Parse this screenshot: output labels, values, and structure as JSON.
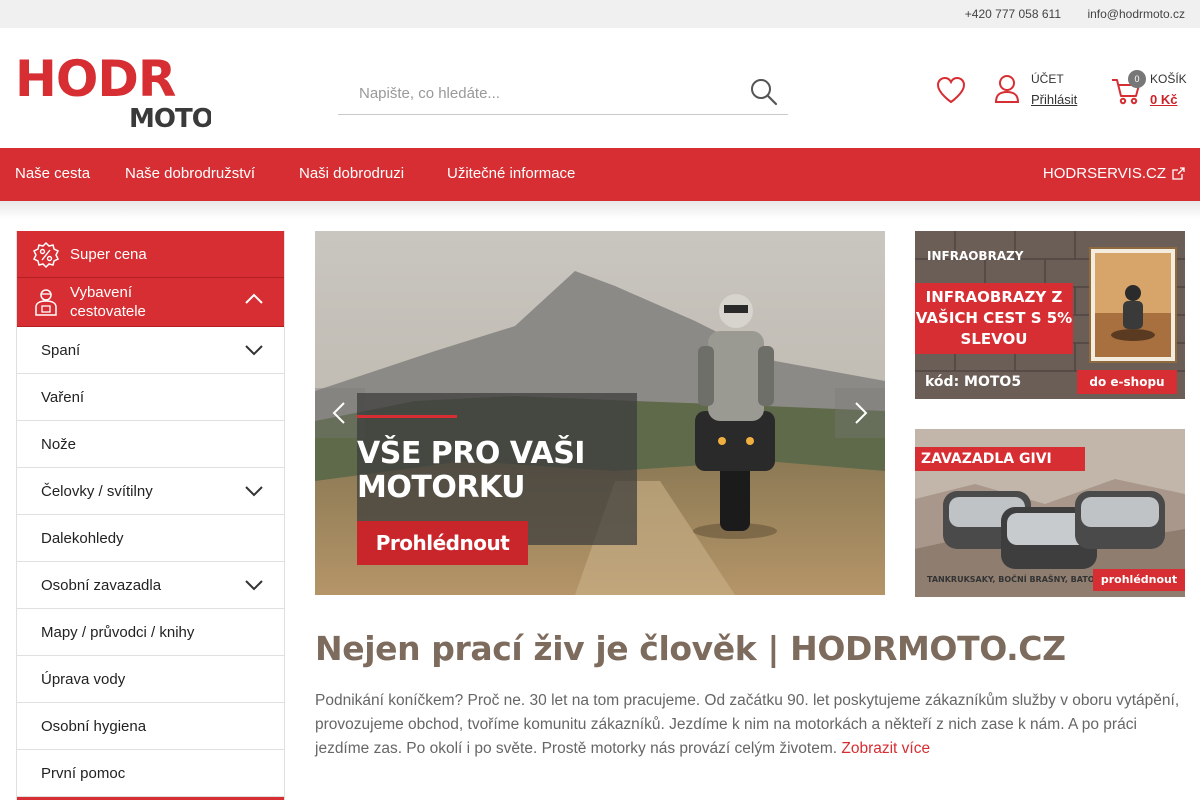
{
  "topbar": {
    "phone": "+420 777 058 611",
    "email": "info@hodrmoto.cz"
  },
  "header": {
    "logo_top": "HODR",
    "logo_bottom": "MOTO",
    "search_placeholder": "Napište, co hledáte...",
    "account_title": "Účet",
    "account_link": "Přihlásit",
    "cart_title": "Košík",
    "cart_count": "0",
    "cart_total": "0 Kč"
  },
  "nav": {
    "items": [
      "Naše cesta",
      "Naše dobrodružství",
      "Naši dobrodruzi",
      "Užitečné informace"
    ],
    "servis": "HODRSERVIS.CZ"
  },
  "sidebar": {
    "super_cena": "Super cena",
    "vybaveni": "Vybavení cestovatele",
    "items": [
      {
        "label": "Spaní",
        "expandable": true
      },
      {
        "label": "Vaření",
        "expandable": false
      },
      {
        "label": "Nože",
        "expandable": false
      },
      {
        "label": "Čelovky / svítilny",
        "expandable": true
      },
      {
        "label": "Dalekohledy",
        "expandable": false
      },
      {
        "label": "Osobní zavazadla",
        "expandable": true
      },
      {
        "label": "Mapy / průvodci / knihy",
        "expandable": false
      },
      {
        "label": "Úprava vody",
        "expandable": false
      },
      {
        "label": "Osobní hygiena",
        "expandable": false
      },
      {
        "label": "První pomoc",
        "expandable": false
      }
    ]
  },
  "hero": {
    "title": "VŠE PRO VAŠI MOTORKU",
    "button": "Prohlédnout"
  },
  "banner1": {
    "brand": "INFRAOBRAZY",
    "headline": "INFRAOBRAZY Z VAŠICH CEST S 5% SLEVOU",
    "code": "kód: MOTO5",
    "button": "do e-shopu"
  },
  "banner2": {
    "headline": "ZAVAZADLA GIVI",
    "footer": "TANKRUKSAKY, BOČNÍ BRAŠNY, BATOHY",
    "button": "prohlédnout"
  },
  "main": {
    "title": "Nejen prací živ je člověk | HODRMOTO.CZ",
    "intro": "Podnikání koníčkem? Proč ne. 30 let na tom pracujeme. Od začátku 90. let poskytujeme zákazníkům služby v oboru vytápění, provozujeme obchod, tvoříme komunitu zákazníků. Jezdíme k nim na motorkách a někteří z nich zase k nám. A po práci jezdíme zas. Po okolí i po světe. Prostě motorky nás provází celým životem.",
    "more": "Zobrazit více"
  },
  "colors": {
    "brand_red": "#d62e32",
    "title_brown": "#7d6b5d"
  }
}
